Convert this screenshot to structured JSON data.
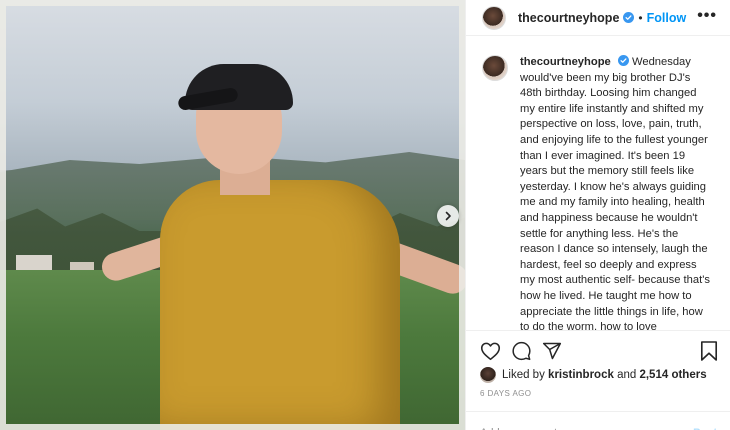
{
  "post": {
    "username": "thecourtneyhope",
    "follow_label": "Follow",
    "separator": "•",
    "more_label": "•••",
    "caption": "Wednesday would've been my big brother DJ's 48th birthday. Loosing him changed my entire life instantly and shifted my perspective on loss, love, pain, truth, and enjoying life to the fullest younger than I ever imagined. It's been 19 years but the memory still feels like yesterday. I know he's always guiding me and my family into healing, health and happiness because he wouldn't settle for anything less. He's the reason I dance so intensely, laugh the hardest, feel so deeply and express my most authentic self- because that's how he lived. He taught me how to appreciate the little things in life, how to do the worm, how to love"
  },
  "likes": {
    "prefix": "Liked by",
    "user": "kristinbrock",
    "joiner": "and",
    "others": "2,514 others"
  },
  "date": "6 DAYS AGO",
  "comment": {
    "placeholder": "Add a comment…",
    "post_label": "Post"
  },
  "colors": {
    "link_blue": "#0095f6",
    "post_disabled": "#b2dffc",
    "muted": "#8e8e8e"
  },
  "icons": [
    "verified-badge-icon",
    "more-options-icon",
    "heart-icon",
    "comment-icon",
    "share-icon",
    "bookmark-icon",
    "chevron-right-icon"
  ]
}
